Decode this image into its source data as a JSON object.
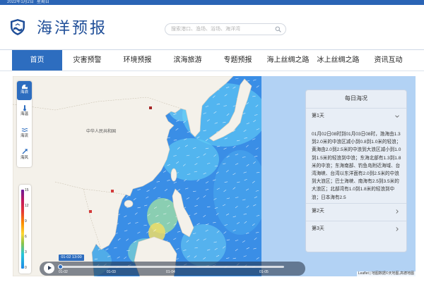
{
  "top_bar": {
    "date": "2022年1月2日",
    "weekday": "星期日"
  },
  "header": {
    "title": "海洋预报",
    "logo_icon": "shield-wave-icon",
    "search_placeholder": "搜索港口、渔场、浴场、海洋湾",
    "search_icon": "search-icon"
  },
  "nav": {
    "items": [
      {
        "label": "首页",
        "active": true
      },
      {
        "label": "灾害预警"
      },
      {
        "label": "环境预报"
      },
      {
        "label": "滨海旅游"
      },
      {
        "label": "专题预报"
      },
      {
        "label": "海上丝绸之路"
      },
      {
        "label": "冰上丝绸之路"
      },
      {
        "label": "资讯互动"
      }
    ]
  },
  "layers": [
    {
      "label": "海浪",
      "icon": "wave-icon",
      "active": true
    },
    {
      "label": "海温",
      "icon": "thermometer-icon"
    },
    {
      "label": "海流",
      "icon": "current-icon"
    },
    {
      "label": "海风",
      "icon": "wind-arrow-icon"
    }
  ],
  "legend": {
    "values": [
      "15",
      "12",
      "9",
      "6",
      "3",
      "0"
    ]
  },
  "map": {
    "labels": [
      "中华人民共和国"
    ]
  },
  "timeline": {
    "current": "01-02 13:00",
    "ticks": [
      "01-02",
      "01-03",
      "01-04",
      "01-05"
    ],
    "progress": 0.0,
    "play_icon": "play-icon"
  },
  "panel": {
    "title": "每日海况",
    "days": [
      {
        "label": "第1天",
        "expanded": true,
        "text": "01月02日08时到01月03日08时，渤海由1.3到2.0米的中浪区减小到0.8到1.0米的轻浪；黄海由2.0到2.5米的中浪到大浪区减小到1.0到1.5米的轻浪到中浪；东海北部有1.3到1.8米的中浪；东海南部、钓鱼岛附近海域、台湾海峡、台湾以东洋面有2.0到2.5米的中浪到大浪区；巴士海峡、南海有2.5到3.5米的大浪区；北部湾有1.0到1.8米的轻浪到中浪；日本海有2.5"
      },
      {
        "label": "第2天",
        "expanded": false
      },
      {
        "label": "第3天",
        "expanded": false
      }
    ]
  },
  "attribution": "Leaflet | 地图数据©天地图,高德地图",
  "colors": {
    "accent": "#2d6dbf",
    "brand": "#1f4e98",
    "top_bar": "#2a64b5"
  }
}
